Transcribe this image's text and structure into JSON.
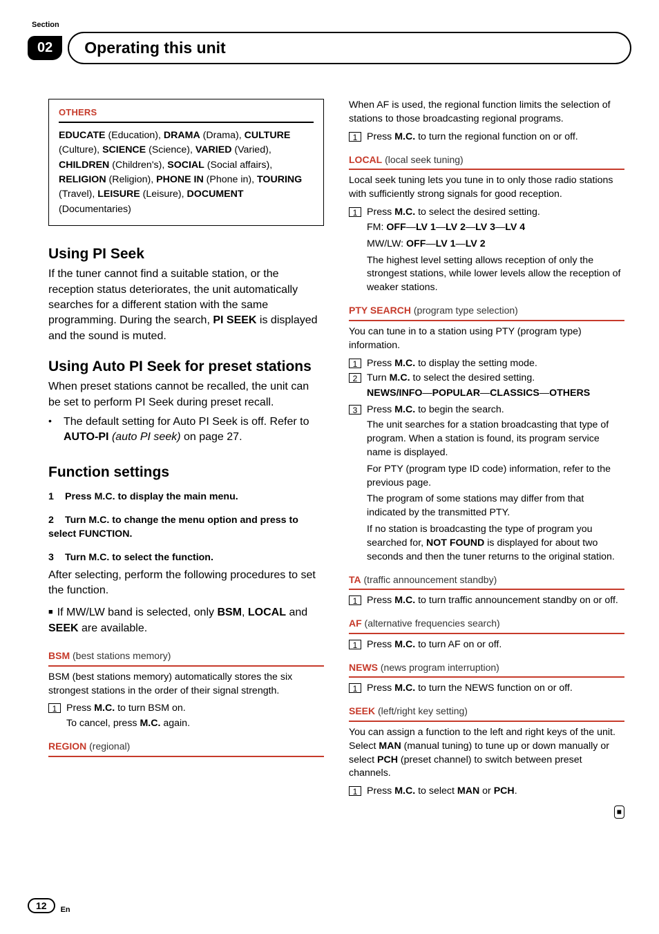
{
  "header": {
    "section_label": "Section",
    "section_number": "02",
    "title": "Operating this unit"
  },
  "left": {
    "others_heading": "OTHERS",
    "others_body_html": "<b>EDUCATE</b> (Education), <b>DRAMA</b> (Drama), <b>CULTURE</b> (Culture), <b>SCIENCE</b> (Science), <b>VARIED</b> (Varied), <b>CHILDREN</b> (Children's), <b>SOCIAL</b> (Social affairs), <b>RELIGION</b> (Religion), <b>PHONE IN</b> (Phone in), <b>TOURING</b> (Travel), <b>LEISURE</b> (Leisure), <b>DOCUMENT</b> (Documentaries)",
    "pi_seek_h": "Using PI Seek",
    "pi_seek_p_html": "If the tuner cannot find a suitable station, or the reception status deteriorates, the unit automatically searches for a different station with the same programming. During the search, <b>PI SEEK</b> is displayed and the sound is muted.",
    "auto_pi_h": "Using Auto PI Seek for preset stations",
    "auto_pi_p": "When preset stations cannot be recalled, the unit can be set to perform PI Seek during preset recall.",
    "auto_pi_bullet_html": "The default setting for Auto PI Seek is off. Refer to <b>AUTO-PI</b> <i>(auto PI seek)</i> on page 27.",
    "func_h": "Function settings",
    "step1": "Press M.C. to display the main menu.",
    "step2": "Turn M.C. to change the menu option and press to select FUNCTION.",
    "step3": "Turn M.C. to select the function.",
    "after_select": "After selecting, perform the following procedures to set the function.",
    "mwlw_note_html": "If MW/LW band is selected, only <b>BSM</b>, <b>LOCAL</b> and <b>SEEK</b>  are available.",
    "bsm_name": "BSM",
    "bsm_desc": " (best stations memory)",
    "bsm_body": "BSM (best stations memory) automatically stores the six strongest stations in the order of their signal strength.",
    "bsm_step_html": "Press <b>M.C.</b> to turn BSM on.",
    "bsm_cancel_html": "To cancel, press <b>M.C.</b> again.",
    "region_name": "REGION",
    "region_desc": " (regional)"
  },
  "right": {
    "af_intro": "When AF is used, the regional function limits the selection of stations to those broadcasting regional programs.",
    "af_step_html": "Press <b>M.C.</b> to turn the regional function on or off.",
    "local_name": "LOCAL",
    "local_desc": " (local seek tuning)",
    "local_body": "Local seek tuning lets you tune in to only those radio stations with sufficiently strong signals for good reception.",
    "local_step_html": "Press <b>M.C.</b> to select the desired setting.",
    "fm_line_html": "FM: <b>OFF</b>—<b>LV 1</b>—<b>LV 2</b>—<b>LV 3</b>—<b>LV 4</b>",
    "mw_line_html": "MW/LW: <b>OFF</b>—<b>LV 1</b>—<b>LV 2</b>",
    "local_note": "The highest level setting allows reception of only the strongest stations, while lower levels allow the reception of weaker stations.",
    "pty_name": "PTY SEARCH",
    "pty_desc": " (program type selection)",
    "pty_body": "You can tune in to a station using PTY (program type) information.",
    "pty_s1_html": "Press <b>M.C.</b> to display the setting mode.",
    "pty_s2_html": "Turn <b>M.C.</b> to select the desired setting.",
    "pty_opts_html": "<b>NEWS/INFO</b>—<b>POPULAR</b>—<b>CLASSICS</b>—<b>OTHERS</b>",
    "pty_s3_html": "Press <b>M.C.</b> to begin the search.",
    "pty_s3_a": "The unit searches for a station broadcasting that type of program. When a station is found, its program service name is displayed.",
    "pty_s3_b": "For PTY (program type ID code) information, refer to the previous page.",
    "pty_s3_c": "The program of some stations may differ from that indicated by the transmitted PTY.",
    "pty_s3_d_html": "If no station is broadcasting the type of program you searched for, <b>NOT FOUND</b> is displayed for about two seconds and then the tuner returns to the original station.",
    "ta_name": "TA",
    "ta_desc": " (traffic announcement standby)",
    "ta_step_html": "Press <b>M.C.</b> to turn traffic announcement standby on or off.",
    "af2_name": "AF",
    "af2_desc": " (alternative frequencies search)",
    "af2_step_html": "Press <b>M.C.</b> to turn AF on or off.",
    "news_name": "NEWS",
    "news_desc": " (news program interruption)",
    "news_step_html": "Press <b>M.C.</b> to turn the NEWS function on or off.",
    "seek_name": "SEEK",
    "seek_desc": " (left/right key setting)",
    "seek_body_html": "You can assign a function to the left and right keys of the unit.<br>Select <b>MAN</b> (manual tuning) to tune up or down manually or select <b>PCH</b> (preset channel) to switch between preset channels.",
    "seek_step_html": "Press <b>M.C.</b> to select <b>MAN</b> or <b>PCH</b>."
  },
  "footer": {
    "page": "12",
    "lang": "En"
  }
}
